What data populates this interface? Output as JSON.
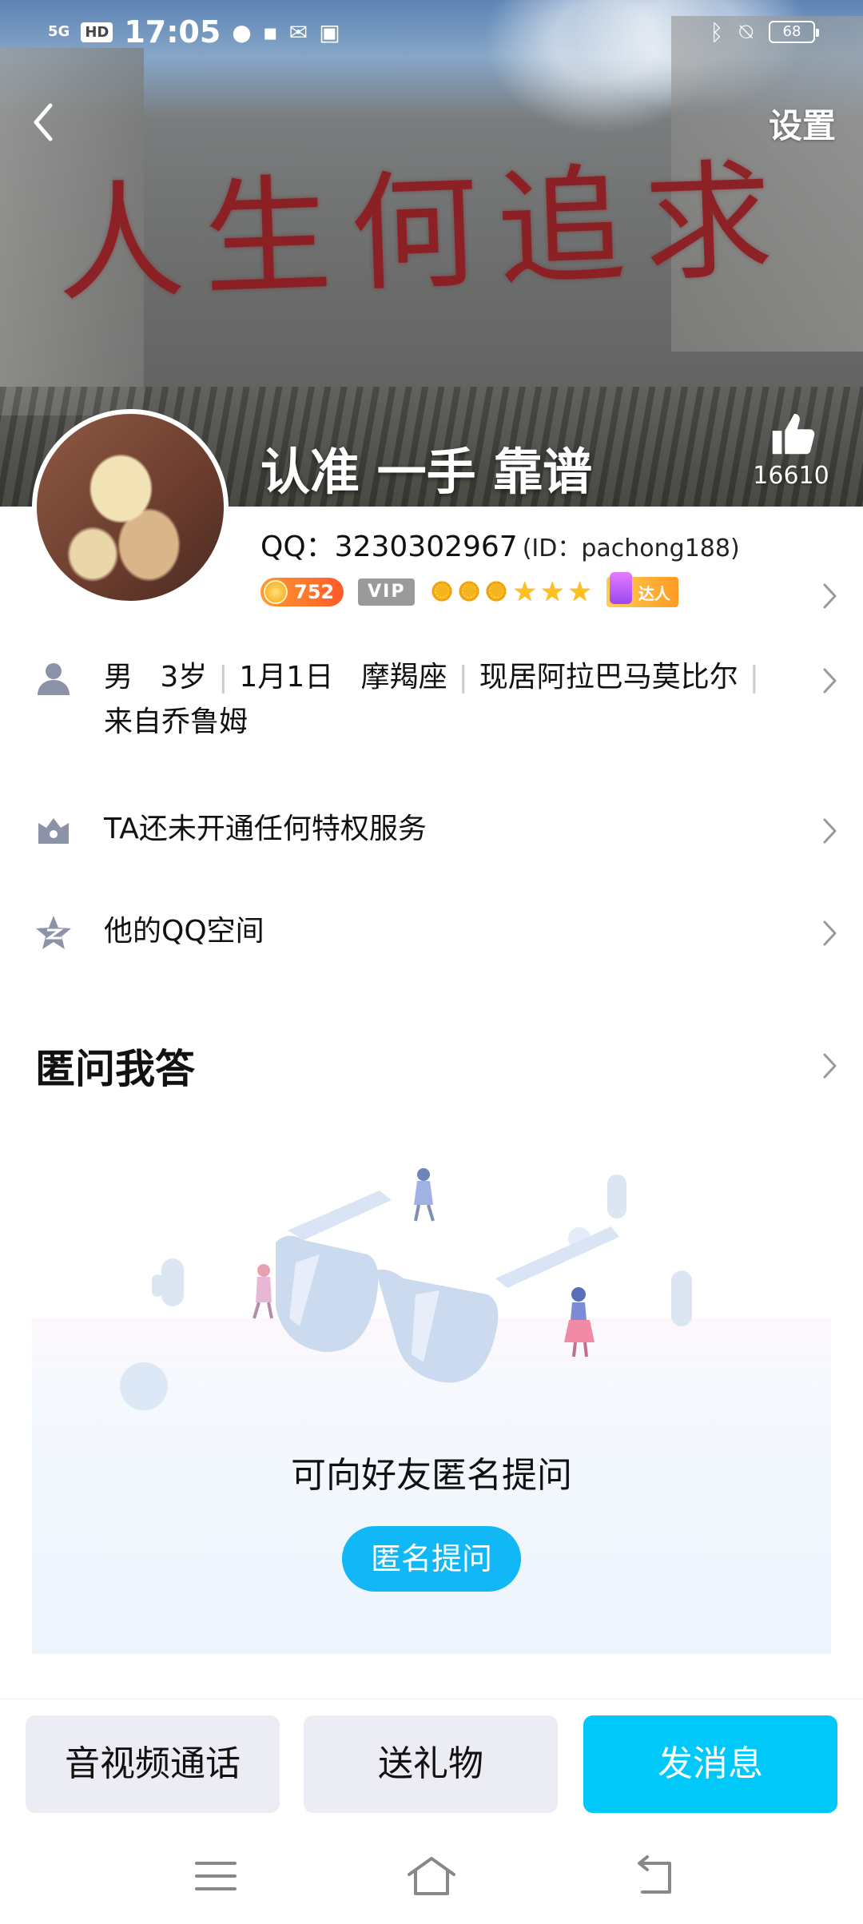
{
  "status_bar": {
    "signal": "5G",
    "hd": "HD",
    "time": "17:05",
    "battery": "68"
  },
  "header": {
    "back_icon": "chevron-left-icon",
    "settings_label": "设置",
    "cover_graffiti": "人生何追求"
  },
  "profile": {
    "nickname": "认准 一手 靠谱",
    "likes": "16610",
    "qq_label": "QQ：3230302967",
    "id_label": "(ID：pachong188)",
    "level_value": "752",
    "vip_label": "VIP",
    "daren_label": "达人"
  },
  "rows": {
    "info": {
      "icon": "person-icon",
      "gender": "男",
      "age": "3岁",
      "birthday": "1月1日",
      "zodiac": "摩羯座",
      "location": "现居阿拉巴马莫比尔",
      "hometown": "来自乔鲁姆"
    },
    "privilege": {
      "icon": "crown-icon",
      "label": "TA还未开通任何特权服务"
    },
    "qzone": {
      "icon": "qzone-star-icon",
      "label": "他的QQ空间"
    }
  },
  "qa": {
    "title": "匿问我答",
    "empty_text": "可向好友匿名提问",
    "ask_button": "匿名提问"
  },
  "bottom_bar": {
    "call_label": "音视频通话",
    "gift_label": "送礼物",
    "message_label": "发消息"
  },
  "colors": {
    "accent": "#00c8f8",
    "ask_button": "#12b7f5",
    "secondary_button_bg": "#ecedf4"
  }
}
